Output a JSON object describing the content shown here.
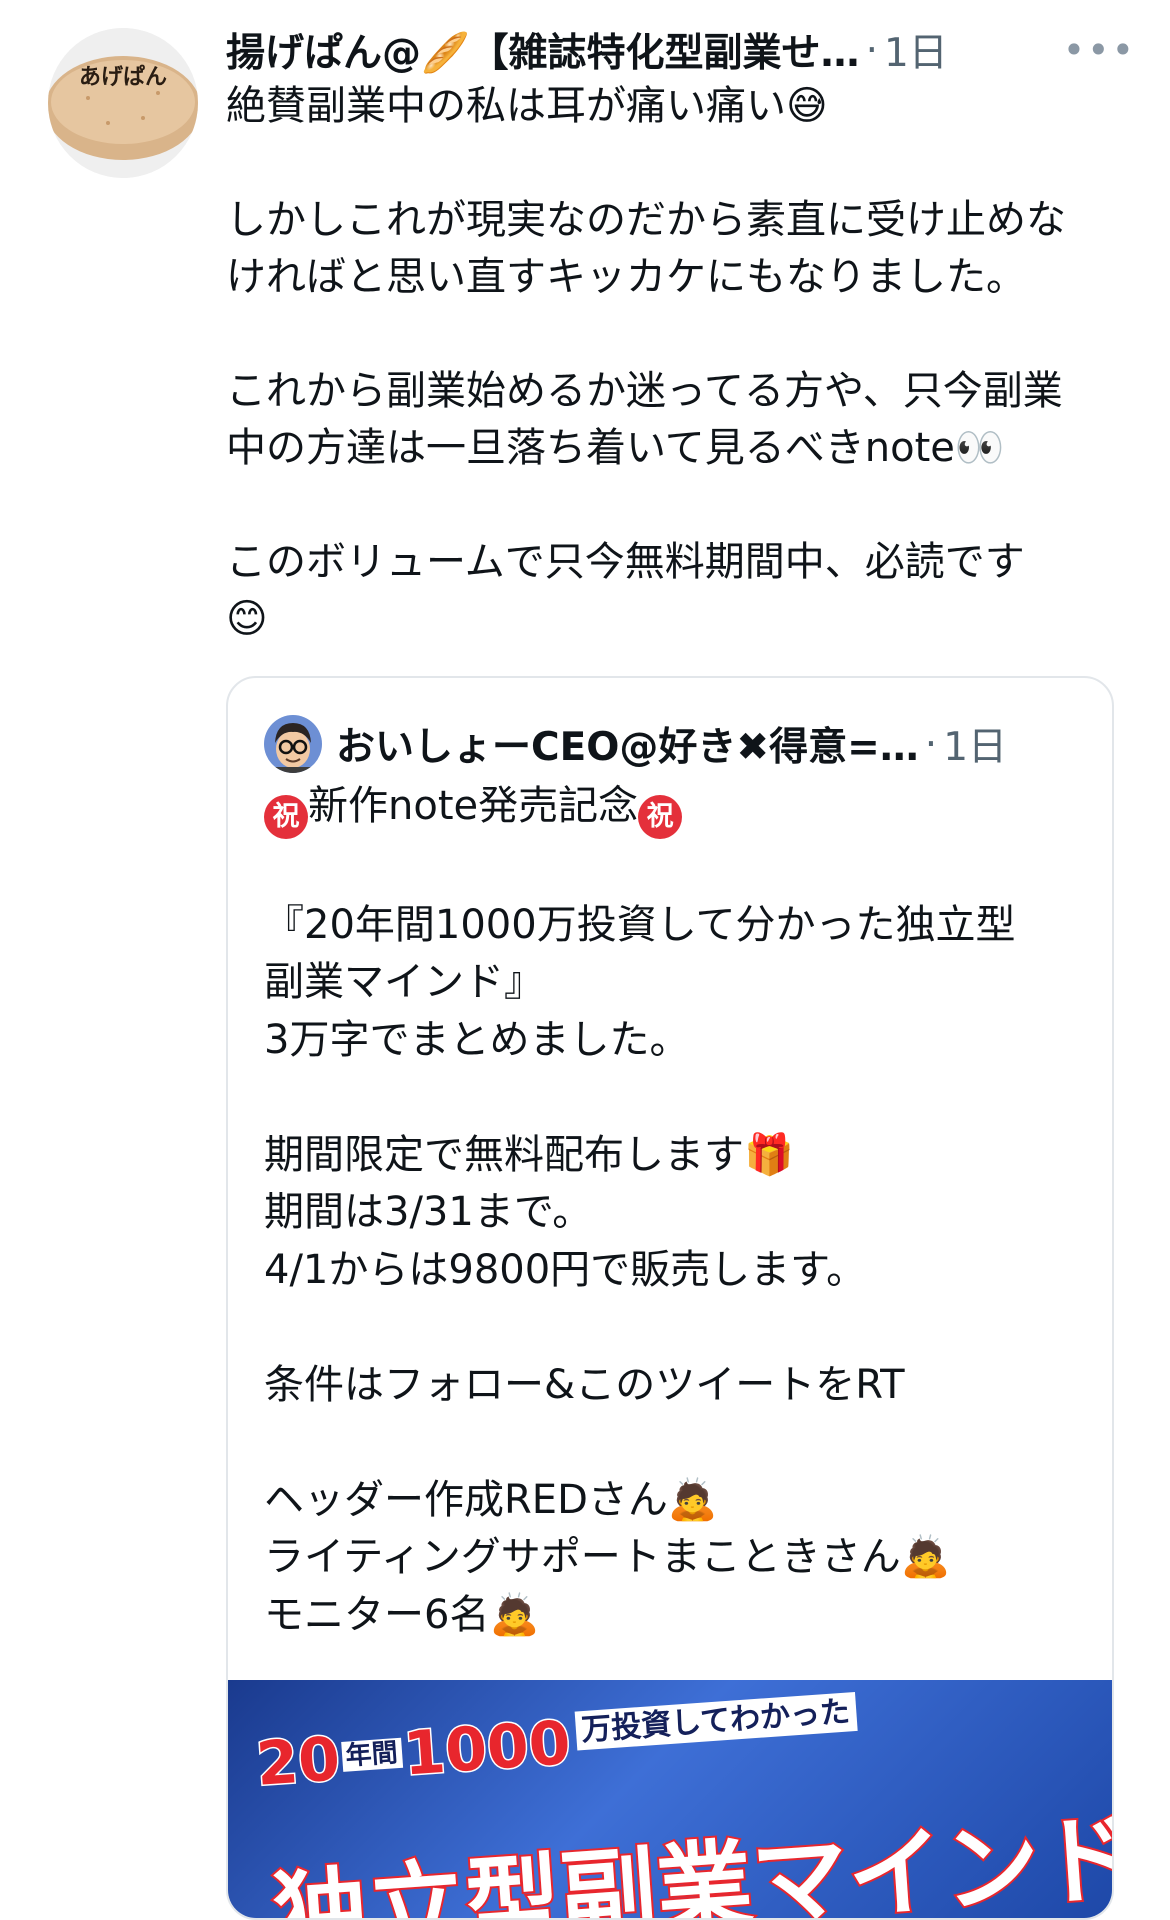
{
  "tweet": {
    "author_display": "揚げぱん@🥖【雑誌特化型副業せ…",
    "avatar_label": "あげぱん",
    "separator": "·",
    "time": "1日",
    "more_label": "•••",
    "text_lines": [
      "絶賛副業中の私は耳が痛い痛い",
      "",
      "しかしこれが現実なのだから素直に受け止めな",
      "ければと思い直すキッカケにもなりました。",
      "",
      "これから副業始めるか迷ってる方や、只今副業",
      "中の方達は一旦落ち着いて見るべきnote👀",
      "",
      "このボリュームで只今無料期間中、必読です"
    ],
    "emoji_after_line1": "😅",
    "emoji_end": "😊"
  },
  "quote": {
    "author_display": "おいしょーCEO@好き✖得意=…",
    "separator": "·",
    "time": "1日",
    "badge": "祝",
    "headline": "新作note発売記念",
    "lines": [
      "",
      "『20年間1000万投資して分かった独立型",
      "副業マインド』",
      "3万字でまとめました。",
      "",
      "期間限定で無料配布します🎁",
      "期間は3/31まで。",
      "4/1からは9800円で販売します。",
      "",
      "条件はフォロー&このツイートをRT",
      "",
      "ヘッダー作成REDさん🙇",
      "ライティングサポートまこときさん🙇",
      "モニター6名🙇"
    ],
    "banner": {
      "years": "20",
      "years_unit": "年間",
      "amount": "1000",
      "tail": "万投資してわかった",
      "title": "独立型副業マインド"
    }
  }
}
